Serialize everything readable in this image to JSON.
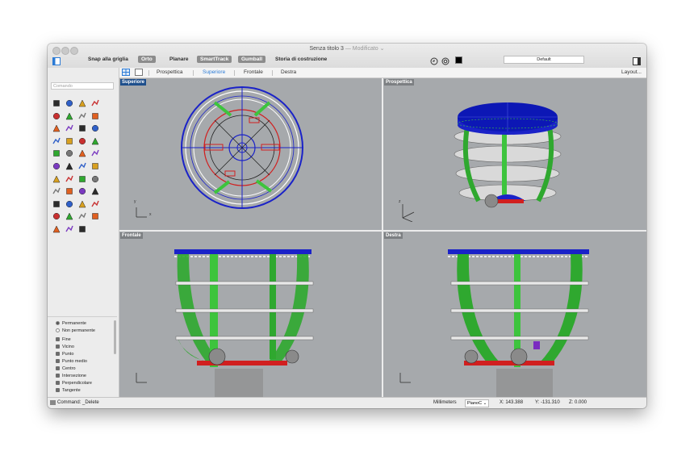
{
  "window": {
    "title": "Senza titolo 3",
    "title_sep": " — ",
    "modified": "Modificato"
  },
  "toolbar": {
    "snap_grid": "Snap alla griglia",
    "orto": "Orto",
    "planare": "Planare",
    "smarttrack": "SmartTrack",
    "gumball": "Gumball",
    "storia": "Storia di costruzione",
    "layer": "Default"
  },
  "tabs": {
    "prospettica": "Prospettica",
    "superiore": "Superiore",
    "frontale": "Frontale",
    "destra": "Destra",
    "layout": "Layout..."
  },
  "sidebar": {
    "command_placeholder": "Comando"
  },
  "osnap": {
    "permanente": "Permanente",
    "non_permanente": "Non permanente",
    "items": [
      "Fine",
      "Vicino",
      "Punto",
      "Punto medio",
      "Centro",
      "Intersezione",
      "Perpendicolare",
      "Tangente"
    ]
  },
  "viewports": {
    "top": "Superiore",
    "persp": "Prospettica",
    "front": "Frontale",
    "right": "Destra"
  },
  "axes": {
    "x": "x",
    "y": "y",
    "z": "z"
  },
  "status": {
    "command": "Command: _Delete",
    "units": "Millimeters",
    "cplane": "PianoC",
    "x": "X: 143.388",
    "y": "Y: -131.310",
    "z": "Z: 0.000"
  },
  "colors": {
    "accent": "#2b7bd6",
    "viewport_bg": "#a6a9ac",
    "model_blue": "#1a22c8",
    "model_green": "#2fa82f",
    "model_red": "#d11f1f"
  }
}
